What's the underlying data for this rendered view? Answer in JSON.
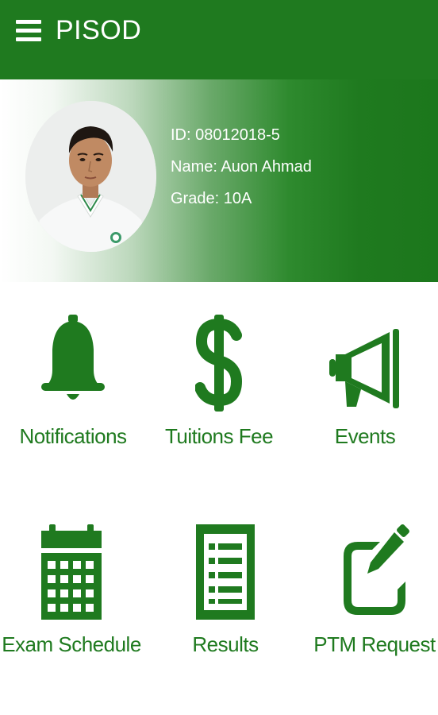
{
  "app_bar": {
    "title": "PISOD",
    "menu_icon": "hamburger-menu-icon",
    "color": "#1f7a1f"
  },
  "profile": {
    "id_text": "ID: 08012018-5",
    "name_text": "Name: Auon Ahmad",
    "grade_text": "Grade: 10A"
  },
  "tiles": [
    {
      "label": "Notifications",
      "icon": "bell-icon"
    },
    {
      "label": "Tuitions Fee",
      "icon": "dollar-icon"
    },
    {
      "label": "Events",
      "icon": "megaphone-icon"
    },
    {
      "label": "Exam Schedule",
      "icon": "calendar-icon"
    },
    {
      "label": "Results",
      "icon": "list-document-icon"
    },
    {
      "label": "PTM Request",
      "icon": "edit-icon"
    }
  ],
  "theme": {
    "primary": "#1f7a1f"
  }
}
